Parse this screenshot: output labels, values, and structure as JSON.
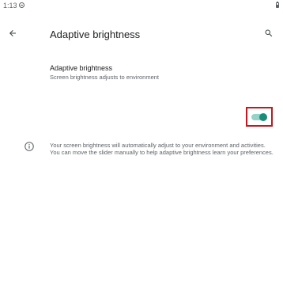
{
  "status_bar": {
    "time": "1:13",
    "dnd_icon": "do-not-disturb-icon",
    "battery_icon": "battery-icon"
  },
  "app_bar": {
    "back_icon": "arrow-back-icon",
    "title": "Adaptive brightness",
    "search_icon": "search-icon"
  },
  "setting": {
    "title": "Adaptive brightness",
    "summary": "Screen brightness adjusts to environment",
    "toggle_on": true,
    "accent_color": "#1a8d79",
    "track_color": "#97d2c6",
    "highlight_color": "#c5171c"
  },
  "footer": {
    "info_icon": "info-icon",
    "text": "Your screen brightness will automatically adjust to your environment and activities. You can move the slider manually to help adaptive brightness learn your preferences."
  }
}
